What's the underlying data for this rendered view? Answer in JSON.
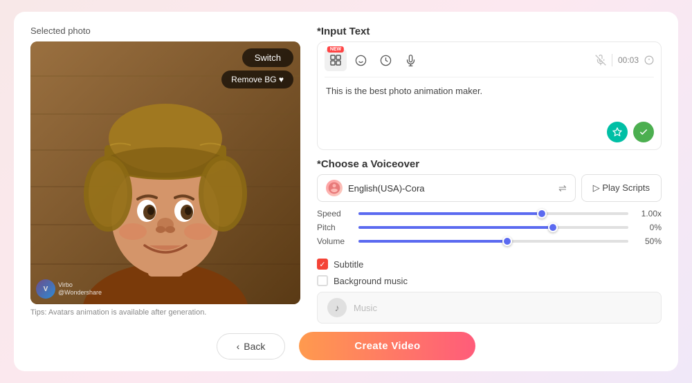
{
  "left_panel": {
    "title": "Selected photo",
    "switch_label": "Switch",
    "remove_bg_label": "Remove BG ♥",
    "watermark": "Virbo",
    "tips": "Tips: Avatars animation is available after generation."
  },
  "input_text": {
    "section_title": "*Input Text",
    "toolbar": {
      "new_badge": "NEW",
      "timer_value": "00:03",
      "icons": [
        "layout-icon",
        "face-icon",
        "clock-icon",
        "mic-icon"
      ]
    },
    "body_text": "This is the best photo animation maker.",
    "ai_btn": "AI",
    "grammar_btn": "G"
  },
  "voiceover": {
    "section_title": "*Choose a Voiceover",
    "voice_name": "English(USA)-Cora",
    "play_scripts_label": "▷ Play Scripts",
    "sliders": [
      {
        "label": "Speed",
        "value": "1.00x",
        "fill_pct": 68
      },
      {
        "label": "Pitch",
        "value": "0%",
        "fill_pct": 72
      },
      {
        "label": "Volume",
        "value": "50%",
        "fill_pct": 55
      }
    ]
  },
  "subtitle": {
    "label": "Subtitle",
    "checked": true
  },
  "background_music": {
    "label": "Background music",
    "checked": false,
    "placeholder": "Music"
  },
  "footer": {
    "back_label": "Back",
    "create_label": "Create Video"
  }
}
